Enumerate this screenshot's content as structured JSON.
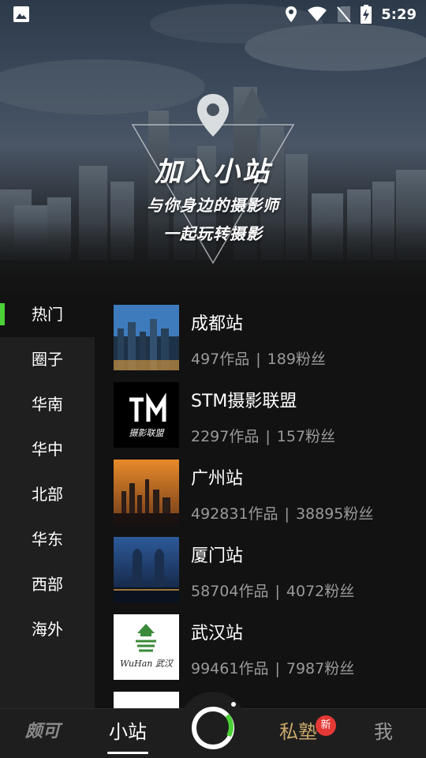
{
  "status_bar": {
    "time": "5:29",
    "icons": [
      "image-icon",
      "location-icon",
      "wifi-icon",
      "no-sim-icon",
      "battery-charging-icon"
    ]
  },
  "hero": {
    "title": "加入小站",
    "subtitle_line1": "与你身边的摄影师",
    "subtitle_line2": "一起玩转摄影",
    "icon": "location-pin-icon"
  },
  "sidebar": {
    "items": [
      {
        "label": "热门",
        "active": true
      },
      {
        "label": "圈子"
      },
      {
        "label": "华南"
      },
      {
        "label": "华中"
      },
      {
        "label": "北部"
      },
      {
        "label": "华东"
      },
      {
        "label": "西部"
      },
      {
        "label": "海外"
      }
    ],
    "accent": "#4cd137"
  },
  "stations": [
    {
      "name": "成都站",
      "works": "497作品",
      "fans": "189粉丝"
    },
    {
      "name": "STM摄影联盟",
      "works": "2297作品",
      "fans": "157粉丝",
      "logo_text": "摄影联盟"
    },
    {
      "name": "广州站",
      "works": "492831作品",
      "fans": "38895粉丝"
    },
    {
      "name": "厦门站",
      "works": "58704作品",
      "fans": "4072粉丝"
    },
    {
      "name": "武汉站",
      "works": "99461作品",
      "fans": "7987粉丝",
      "logo_text": "WuHan 武汉"
    }
  ],
  "stats_separator": "|",
  "bottom_nav": {
    "logo": "颇可",
    "station": "小站",
    "private": "私塾",
    "me": "我",
    "badge": "新"
  }
}
